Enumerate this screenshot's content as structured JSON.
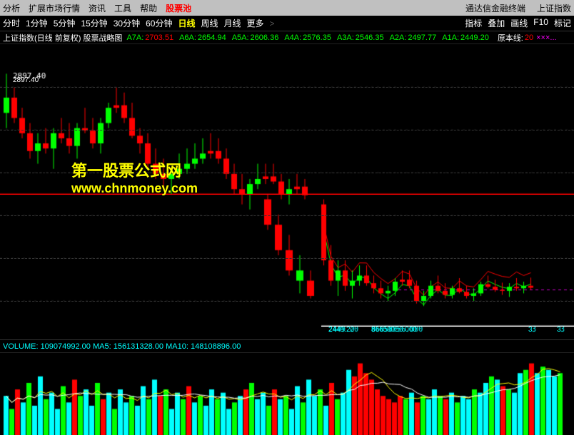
{
  "menu": {
    "items": [
      "分析",
      "扩展市场行情",
      "资讯",
      "工具",
      "帮助",
      "股票池"
    ],
    "active": "股票池",
    "right": [
      "通达信金融终端",
      "上证指数"
    ]
  },
  "toolbar": {
    "items": [
      "分时",
      "1分钟",
      "5分钟",
      "15分钟",
      "30分钟",
      "60分钟",
      "日线",
      "周线",
      "月线",
      "更多"
    ],
    "active": "日线",
    "right": [
      "指标",
      "叠加",
      "画线",
      "F10",
      "标记"
    ]
  },
  "databar": {
    "title": "上证指数(日线 前复权) 股票战略图",
    "items": [
      {
        "label": "A7A:",
        "value": "2703.51",
        "color": "red"
      },
      {
        "label": "A6A:",
        "value": "2654.94",
        "color": "green"
      },
      {
        "label": "A5A:",
        "value": "2606.36",
        "color": "green"
      },
      {
        "label": "A4A:",
        "value": "2576.35",
        "color": "green"
      },
      {
        "label": "A3A:",
        "value": "2546.35",
        "color": "green"
      },
      {
        "label": "A2A:",
        "value": "2497.77",
        "color": "green"
      },
      {
        "label": "A1A:",
        "value": "2449.20",
        "color": "green"
      }
    ],
    "original": "原本线: 20"
  },
  "chart": {
    "topPrice": "2897.40",
    "priceLevel1": "2449.20",
    "priceLevel2": "86658056.000",
    "priceLevel3": "3",
    "priceLevel4": "3"
  },
  "volumeBar": {
    "text": "VOLUME: 109074992.00  MA5: 156131328.00  MA10: 148108896.00"
  },
  "watermark": {
    "line1": "第一股票公式网",
    "line2": "www.chnmoney.com"
  }
}
